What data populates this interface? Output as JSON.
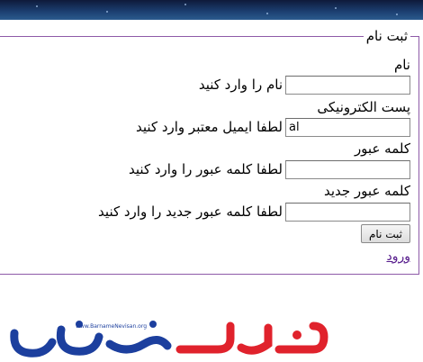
{
  "form": {
    "legend": "ثبت نام",
    "fields": [
      {
        "label": "نام",
        "hint": "نام را وارد کنید",
        "value": ""
      },
      {
        "label": "پست الکترونیکی",
        "hint": "لطفا ایمیل معتبر وارد کنید",
        "value": "al"
      },
      {
        "label": "کلمه عبور",
        "hint": "لطفا کلمه عبور را وارد کنید",
        "value": ""
      },
      {
        "label": "کلمه عبور جدید",
        "hint": "لطفا کلمه عبور جدید را وارد کنید",
        "value": ""
      }
    ],
    "submit_label": "ثبت نام",
    "login_link": "ورود"
  },
  "logo": {
    "url_text": "www.BarnameNevisan.org",
    "colors": {
      "blue": "#1c3f9e",
      "red": "#e0222c"
    }
  },
  "theme": {
    "frame_border": "#8e5aa8",
    "link": "#551a8b",
    "banner": "#1b3d6e"
  }
}
